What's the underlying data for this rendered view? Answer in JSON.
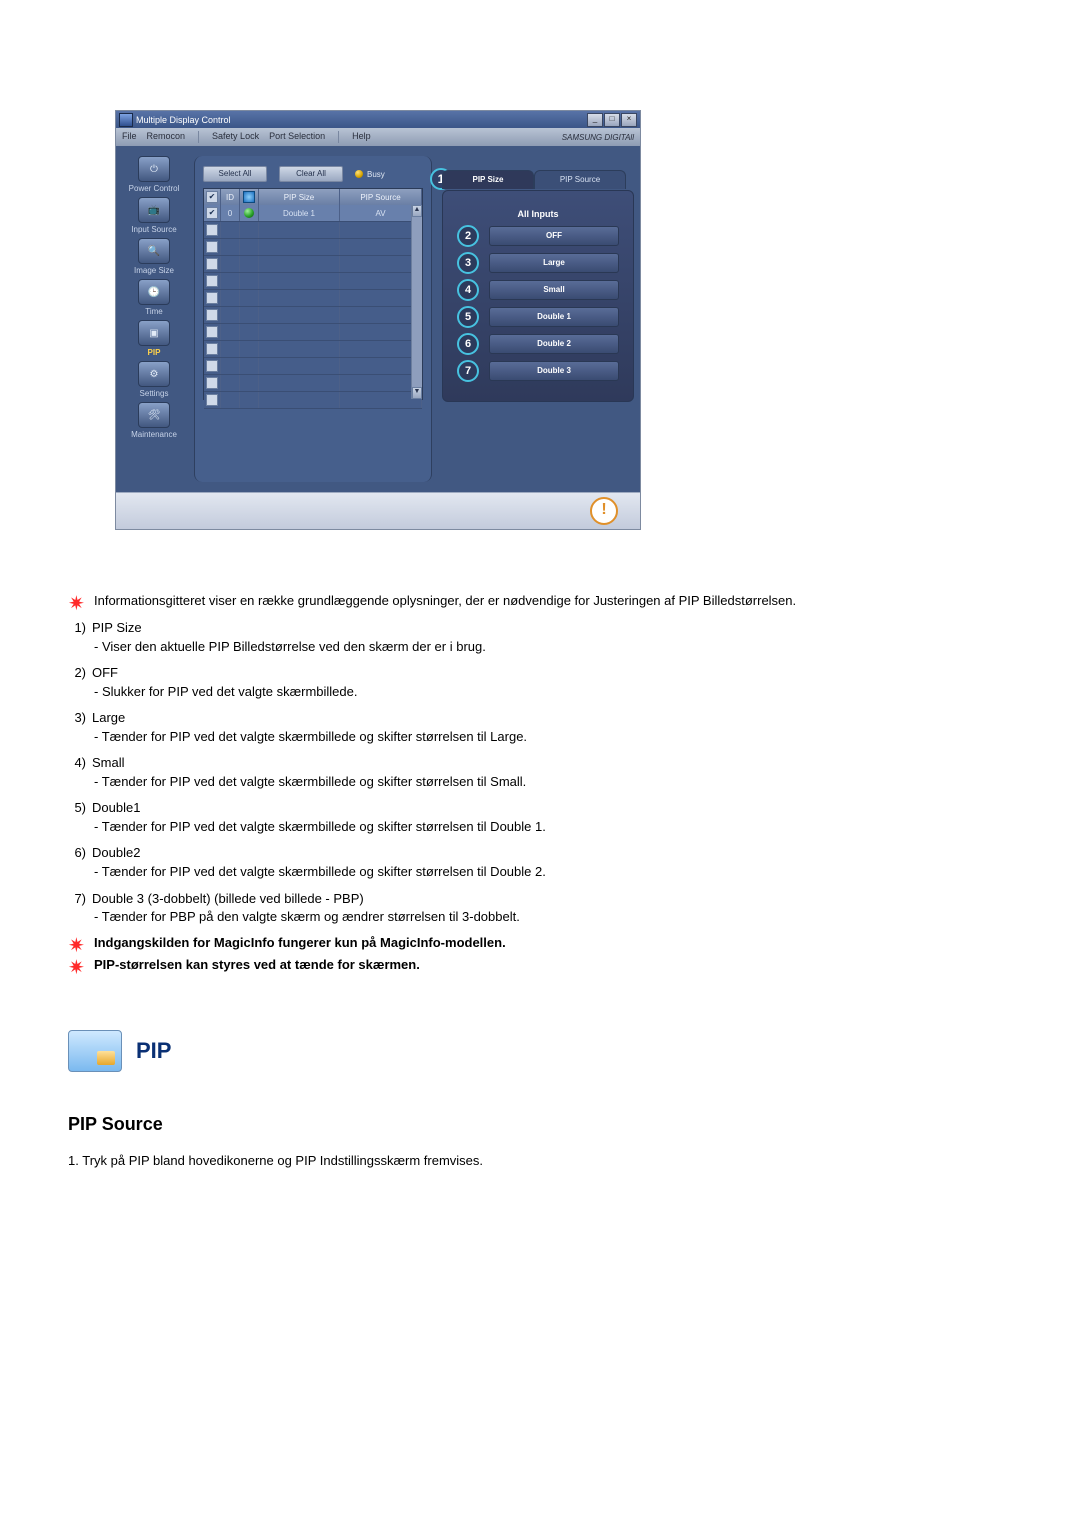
{
  "app": {
    "title": "Multiple Display Control",
    "brand": "SAMSUNG DIGITAll",
    "menus": [
      "File",
      "Remocon",
      "Safety Lock",
      "Port Selection",
      "Help"
    ],
    "toolbar": {
      "selectAll": "Select All",
      "clearAll": "Clear All",
      "busy": "Busy"
    },
    "sidebar": [
      {
        "label": "Power Control",
        "icon": "power-icon"
      },
      {
        "label": "Input Source",
        "icon": "input-icon"
      },
      {
        "label": "Image Size",
        "icon": "imagesize-icon"
      },
      {
        "label": "Time",
        "icon": "time-icon"
      },
      {
        "label": "PIP",
        "icon": "pip-icon",
        "active": true
      },
      {
        "label": "Settings",
        "icon": "settings-icon"
      },
      {
        "label": "Maintenance",
        "icon": "maintenance-icon"
      }
    ],
    "grid": {
      "headers": [
        "",
        "ID",
        "",
        "PIP Size",
        "PIP Source"
      ],
      "row0": {
        "id": "0",
        "pipsize": "Double 1",
        "pipsrc": "AV"
      }
    },
    "rightPanel": {
      "tabs": {
        "active": "PIP Size",
        "other": "PIP Source",
        "callout": "1"
      },
      "subhead": "All Inputs",
      "options": [
        {
          "num": "2",
          "label": "OFF"
        },
        {
          "num": "3",
          "label": "Large"
        },
        {
          "num": "4",
          "label": "Small"
        },
        {
          "num": "5",
          "label": "Double 1"
        },
        {
          "num": "6",
          "label": "Double 2"
        },
        {
          "num": "7",
          "label": "Double 3"
        }
      ]
    }
  },
  "doc": {
    "intro": "Informationsgitteret viser en række grundlæggende oplysninger, der er nødvendige for Justeringen af PIP Billedstørrelsen.",
    "items": [
      {
        "n": "1)",
        "t": "PIP Size",
        "d": "- Viser den aktuelle PIP Billedstørrelse ved den skærm der er i brug."
      },
      {
        "n": "2)",
        "t": "OFF",
        "d": "- Slukker for PIP ved det valgte skærmbillede."
      },
      {
        "n": "3)",
        "t": "Large",
        "d": "- Tænder for PIP ved det valgte skærmbillede og skifter størrelsen til Large."
      },
      {
        "n": "4)",
        "t": "Small",
        "d": "- Tænder for PIP ved det valgte skærmbillede og skifter størrelsen til Small."
      },
      {
        "n": "5)",
        "t": "Double1",
        "d": "- Tænder for PIP ved det valgte skærmbillede og skifter størrelsen til Double 1."
      },
      {
        "n": "6)",
        "t": "Double2",
        "d": "- Tænder for PIP ved det valgte skærmbillede og skifter størrelsen til Double 2."
      },
      {
        "n": "7)",
        "t": "Double 3 (3-dobbelt) (billede ved billede - PBP)",
        "d": "- Tænder for PBP på den valgte skærm og ændrer størrelsen til 3-dobbelt."
      }
    ],
    "stars": [
      "Indgangskilden for MagicInfo fungerer kun på MagicInfo-modellen.",
      "PIP-størrelsen kan styres ved at tænde for skærmen."
    ]
  },
  "sectionPip": {
    "logoTitle": "PIP",
    "heading": "PIP Source",
    "step1_n": "1.",
    "step1": "Tryk på PIP bland hovedikonerne og PIP Indstillingsskærm fremvises."
  }
}
